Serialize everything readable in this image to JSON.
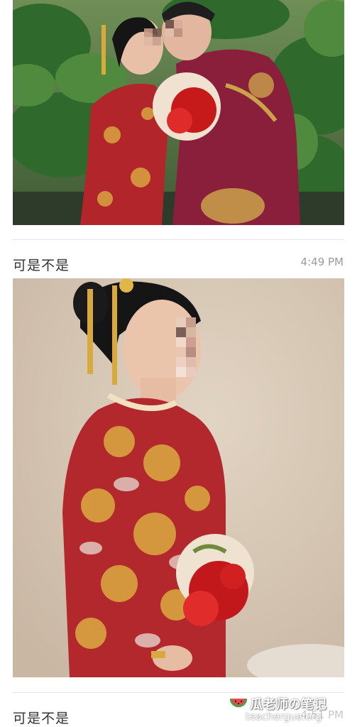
{
  "posts": [
    {
      "image": "couple-wedding-photo",
      "title": "",
      "time": ""
    },
    {
      "image": "bride-portrait-photo",
      "title": "可是不是",
      "time": "4:49 PM"
    },
    {
      "title": "可是不是",
      "time": "4:51 PM"
    }
  ],
  "watermark": {
    "title": "瓜老师の笔记",
    "url": "teachergua.org",
    "icon": "watermelon-icon"
  },
  "colors": {
    "divider": "#e6e6e6",
    "title_text": "#333333",
    "time_text": "#9b9b9b",
    "background": "#ffffff"
  }
}
